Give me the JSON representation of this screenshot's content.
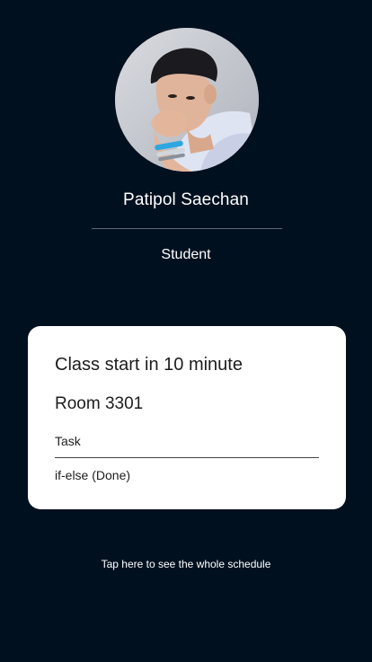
{
  "profile": {
    "name": "Patipol Saechan",
    "role": "Student"
  },
  "class_card": {
    "headline": "Class start in 10 minute",
    "room": "Room 3301",
    "task_label": "Task",
    "task_items": [
      "if-else (Done)"
    ]
  },
  "footer": {
    "schedule_link": "Tap here to see the whole schedule"
  },
  "colors": {
    "background": "#01101f",
    "card": "#ffffff",
    "text_light": "#ffffff",
    "text_dark": "#1d1d1d"
  }
}
